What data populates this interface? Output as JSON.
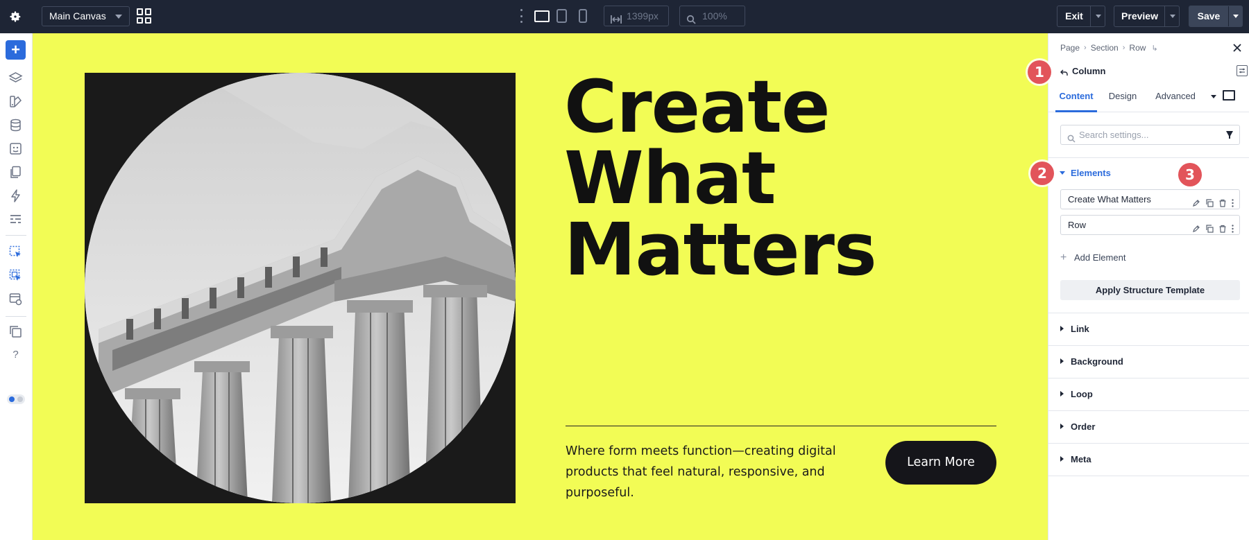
{
  "topbar": {
    "canvas_name": "Main Canvas",
    "width_value": "1399px",
    "zoom_value": "100%",
    "exit_label": "Exit",
    "preview_label": "Preview",
    "save_label": "Save"
  },
  "canvas": {
    "title_lines": [
      "Create",
      "What",
      "Matters"
    ],
    "description": "Where form meets function—creating digital products that feel natural, responsive, and purposeful.",
    "button_label": "Learn More",
    "background_color": "#f2fc55"
  },
  "panel": {
    "breadcrumb": [
      "Page",
      "Section",
      "Row"
    ],
    "title": "Column",
    "tabs": [
      "Content",
      "Design",
      "Advanced"
    ],
    "search_placeholder": "Search settings...",
    "elements_heading": "Elements",
    "elements": [
      "Create What Matters",
      "Row"
    ],
    "add_element_label": "Add Element",
    "apply_template_label": "Apply Structure Template",
    "sections": [
      "Link",
      "Background",
      "Loop",
      "Order",
      "Meta"
    ]
  },
  "badges": [
    "1",
    "2",
    "3"
  ],
  "colors": {
    "accent": "#2b6bdc",
    "topbar": "#1e2535",
    "badge": "#e2545a"
  }
}
